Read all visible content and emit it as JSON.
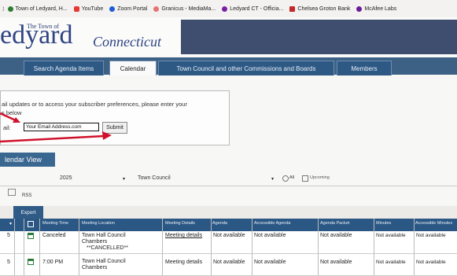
{
  "bookmarks": [
    {
      "label": "Town of Ledyard, H...",
      "color": "#2e7d32"
    },
    {
      "label": "YouTube",
      "color": "#e53935"
    },
    {
      "label": "Zoom Portal",
      "color": "#1e5bd6"
    },
    {
      "label": "Granicus - MediaMa...",
      "color": "#e57373"
    },
    {
      "label": "Ledyard CT - Officia...",
      "color": "#7b1fa2"
    },
    {
      "label": "Chelsea Groton Bank",
      "color": "#c62828"
    },
    {
      "label": "McAfee Labs",
      "color": "#6a1b9a"
    }
  ],
  "logo": {
    "small": "The Town of",
    "big": "edyard",
    "sub": "Connecticut"
  },
  "tabs": [
    {
      "label": "Search Agenda Items"
    },
    {
      "label": "Calendar"
    },
    {
      "label": "Town Council and other Commissions and Boards"
    },
    {
      "label": "Members"
    }
  ],
  "subscribe": {
    "line1": "ail updates or to access your subscriber preferences, please enter your",
    "line2": "s below",
    "field_label": "ail:",
    "email_value": "Your Email Address.com",
    "submit": "Submit"
  },
  "calendar_view": "lendar View",
  "filters": {
    "year": "2025",
    "body": "Town Council",
    "radio_a": "All",
    "radio_b": "Upcoming"
  },
  "rss": "RSS",
  "export": "Export",
  "columns": [
    "Meeting Time",
    "Meeting Location",
    "Meeting Details",
    "Agenda",
    "Accessible Agenda",
    "Agenda Packet",
    "Minutes",
    "Accessible Minutes"
  ],
  "rows": [
    {
      "time": "Canceled",
      "location_1": "Town Hall Council",
      "location_2": "Chambers",
      "location_3": "**CANCELLED**",
      "details": "Meeting details",
      "agenda": "Not available",
      "acc_agenda": "Not available",
      "packet": "Not available",
      "minutes": "Not available",
      "acc_minutes": "Not available"
    },
    {
      "time": "7:00 PM",
      "location_1": "Town Hall Council",
      "location_2": "Chambers",
      "location_3": "",
      "details": "Meeting details",
      "agenda": "Not available",
      "acc_agenda": "Not available",
      "packet": "Not available",
      "minutes": "Not available",
      "acc_minutes": "Not available"
    }
  ],
  "colors": {
    "tabbar": "#3d6185",
    "header_block": "#3f4d6f",
    "table_head": "#2a5784",
    "arrow": "#d0112b"
  }
}
